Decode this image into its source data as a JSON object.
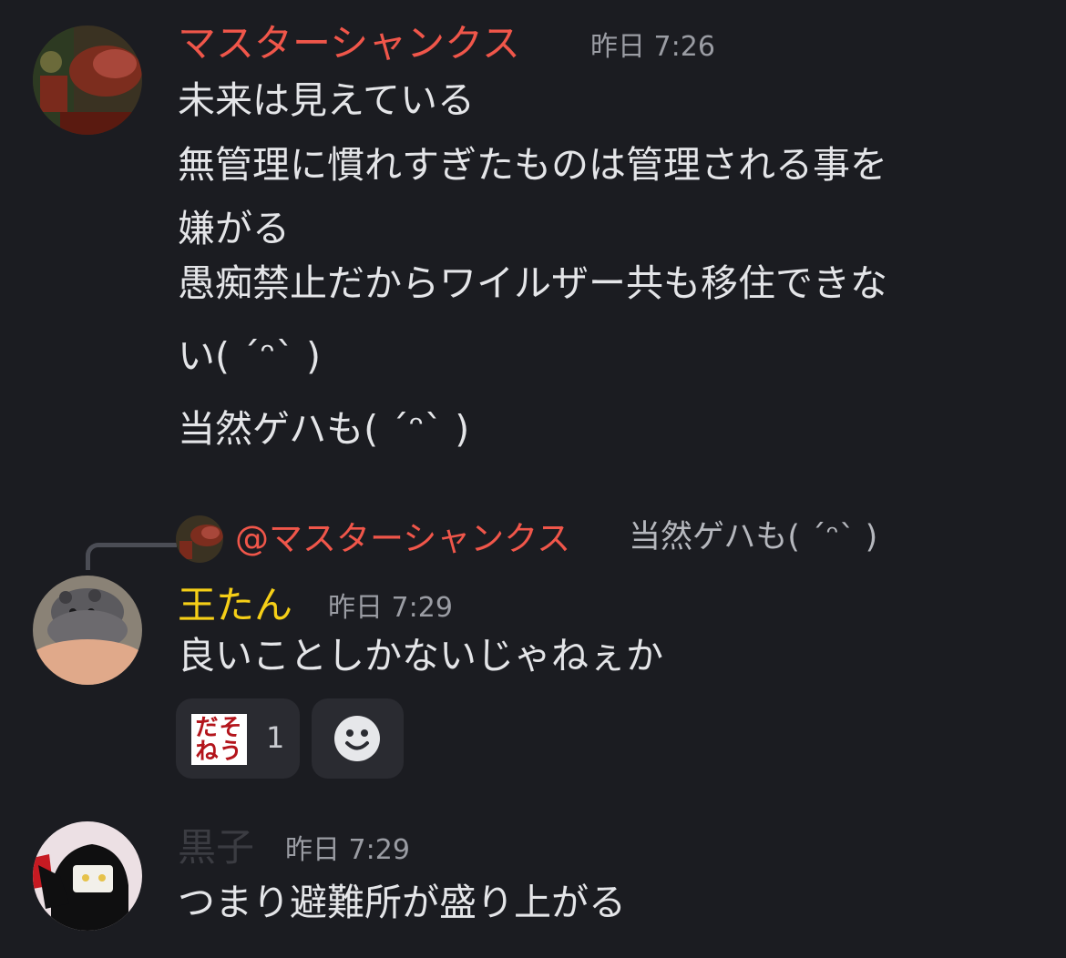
{
  "messages": [
    {
      "author": "マスターシャンクス",
      "author_color": "#f0564a",
      "time": "昨日 7:26",
      "lines": [
        "未来は見えている",
        "無管理に慣れすぎたものは管理される事を",
        "嫌がる",
        "愚痴禁止だからワイルザー共も移住できな",
        "い( ˊᵔˋ )",
        "当然ゲハも( ˊᵔˋ )"
      ]
    },
    {
      "reply_to": {
        "mention": "@マスターシャンクス",
        "text": "当然ゲハも( ˊᵔˋ )"
      },
      "author": "王たん",
      "author_color": "#f6cf17",
      "time": "昨日 7:29",
      "lines": [
        "良いことしかないじゃねぇか"
      ],
      "reactions": [
        {
          "emoji_text": [
            "だそ",
            "ねう"
          ],
          "count": "1"
        }
      ],
      "add_reaction_icon": "smiley-face-icon"
    },
    {
      "author": "黒子",
      "author_color": "#3b3c42",
      "time": "昨日 7:29",
      "lines": [
        "つまり避難所が盛り上がる"
      ]
    }
  ]
}
